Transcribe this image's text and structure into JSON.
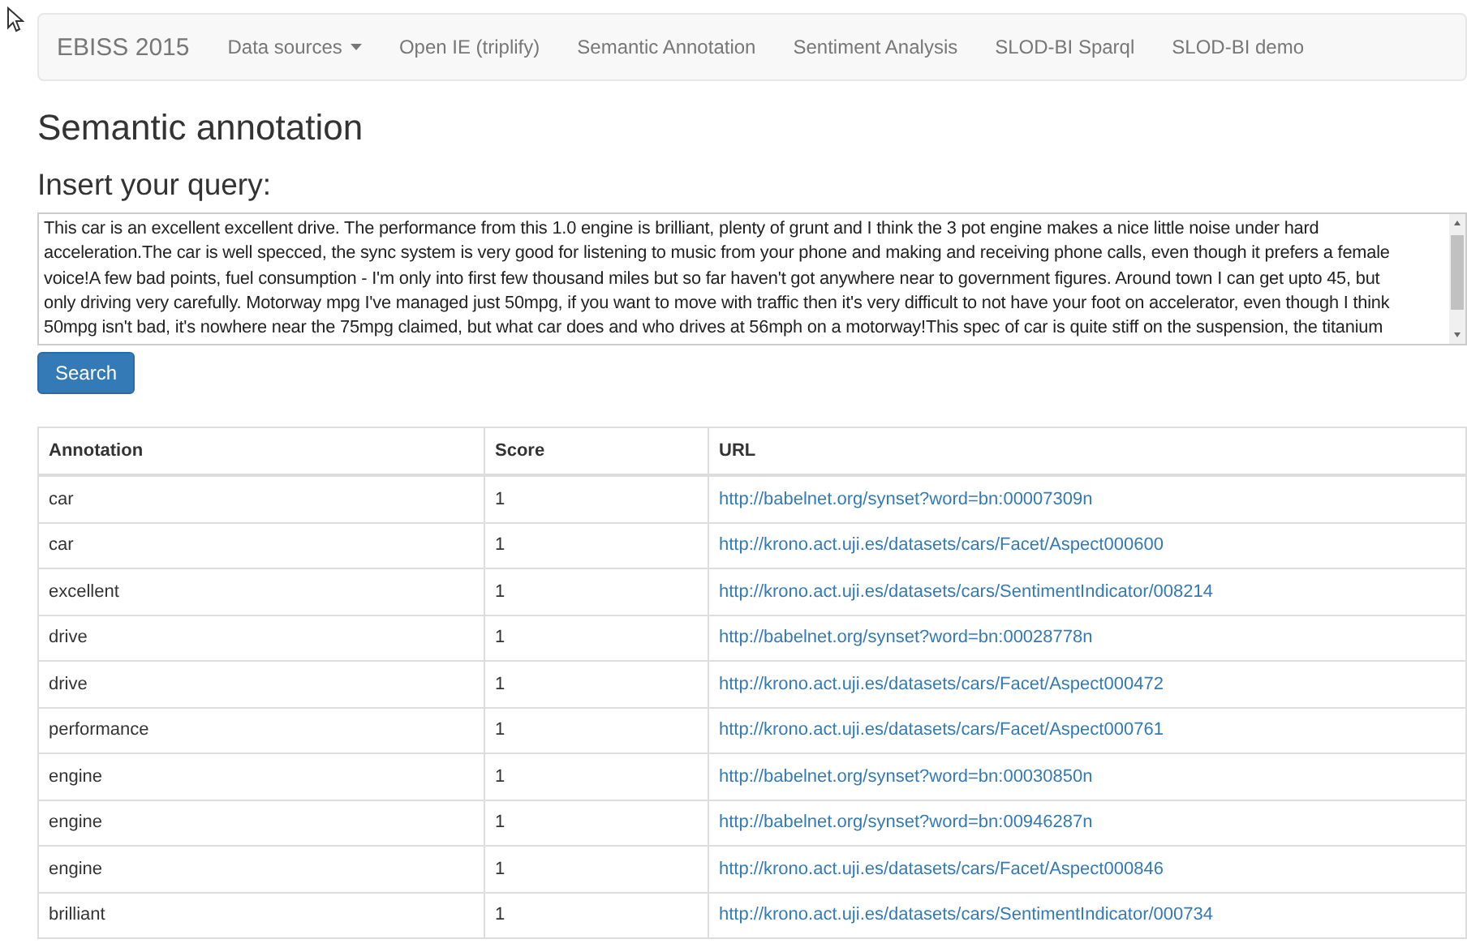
{
  "navbar": {
    "brand": "EBISS 2015",
    "items": [
      {
        "label": "Data sources",
        "kind": "dropdown",
        "selected": false
      },
      {
        "label": "Open IE (triplify)",
        "kind": "link",
        "selected": false
      },
      {
        "label": "Semantic Annotation",
        "kind": "link",
        "selected": false
      },
      {
        "label": "Sentiment Analysis",
        "kind": "link",
        "selected": false
      },
      {
        "label": "SLOD-BI Sparql",
        "kind": "link",
        "selected": false
      },
      {
        "label": "SLOD-BI demo",
        "kind": "link",
        "selected": false
      }
    ]
  },
  "heading": "Semantic annotation",
  "query": {
    "label": "Insert your query:",
    "lines": [
      "This car is an excellent excellent drive. The performance from this 1.0 engine is brilliant, plenty of grunt and I think the 3 pot engine makes a nice little noise under hard",
      "acceleration.The car is well specced, the sync system is very good for listening to music from your phone and making and receiving phone calls, even though it prefers a female",
      "voice!A few bad points, fuel consumption - I'm only into first few thousand miles but so far haven't got anywhere near to government figures. Around town I can get upto 45, but",
      "only driving very carefully. Motorway mpg I've managed just 50mpg, if you want to move with traffic then it's very difficult to not have your foot on accelerator, even though I think",
      "50mpg isn't bad, it's nowhere near the 75mpg claimed, but what car does and who drives at 56mph on a motorway!This spec of car is quite stiff on the suspension, the titanium"
    ]
  },
  "search_button": "Search",
  "table": {
    "columns": [
      "Annotation",
      "Score",
      "URL"
    ],
    "rows": [
      [
        "car",
        "1",
        "http://babelnet.org/synset?word=bn:00007309n"
      ],
      [
        "car",
        "1",
        "http://krono.act.uji.es/datasets/cars/Facet/Aspect000600"
      ],
      [
        "excellent",
        "1",
        "http://krono.act.uji.es/datasets/cars/SentimentIndicator/008214"
      ],
      [
        "drive",
        "1",
        "http://babelnet.org/synset?word=bn:00028778n"
      ],
      [
        "drive",
        "1",
        "http://krono.act.uji.es/datasets/cars/Facet/Aspect000472"
      ],
      [
        "performance",
        "1",
        "http://krono.act.uji.es/datasets/cars/Facet/Aspect000761"
      ],
      [
        "engine",
        "1",
        "http://babelnet.org/synset?word=bn:00030850n"
      ],
      [
        "engine",
        "1",
        "http://babelnet.org/synset?word=bn:00946287n"
      ],
      [
        "engine",
        "1",
        "http://krono.act.uji.es/datasets/cars/Facet/Aspect000846"
      ],
      [
        "brilliant",
        "1",
        "http://krono.act.uji.es/datasets/cars/SentimentIndicator/000734"
      ]
    ]
  }
}
